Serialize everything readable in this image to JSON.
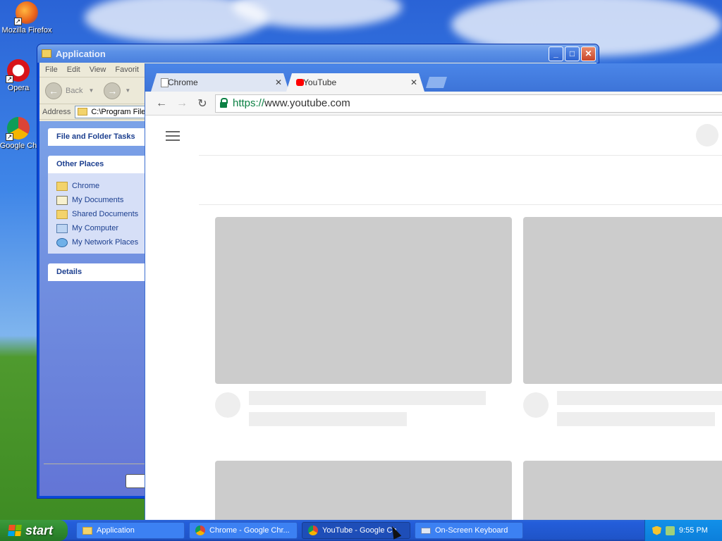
{
  "desktop": {
    "icons": [
      {
        "label": "Mozilla Firefox"
      },
      {
        "label": "Opera"
      },
      {
        "label": "Google Ch"
      }
    ]
  },
  "explorer": {
    "title": "Application",
    "menu": [
      "File",
      "Edit",
      "View",
      "Favorit"
    ],
    "toolbar": {
      "back_label": "Back"
    },
    "address": {
      "label": "Address",
      "value": "C:\\Program Files"
    },
    "panes": {
      "file_tasks": "File and Folder Tasks",
      "other_places": {
        "title": "Other Places",
        "items": [
          "Chrome",
          "My Documents",
          "Shared Documents",
          "My Computer",
          "My Network Places"
        ]
      },
      "details": "Details"
    }
  },
  "chrome": {
    "tabs": [
      {
        "label": "Chrome"
      },
      {
        "label": "YouTube"
      }
    ],
    "url": {
      "scheme": "https://",
      "rest": "www.youtube.com"
    }
  },
  "taskbar": {
    "start_label": "start",
    "tasks": [
      {
        "label": "Application"
      },
      {
        "label": "Chrome - Google Chr..."
      },
      {
        "label": "YouTube - Google Ch"
      },
      {
        "label": "On-Screen Keyboard"
      }
    ],
    "clock": "9:55 PM"
  },
  "colors": {
    "xp_blue": "#245edb",
    "start_green": "#2f8a2f",
    "youtube_red": "#ff0000",
    "https_green": "#0b8043"
  }
}
